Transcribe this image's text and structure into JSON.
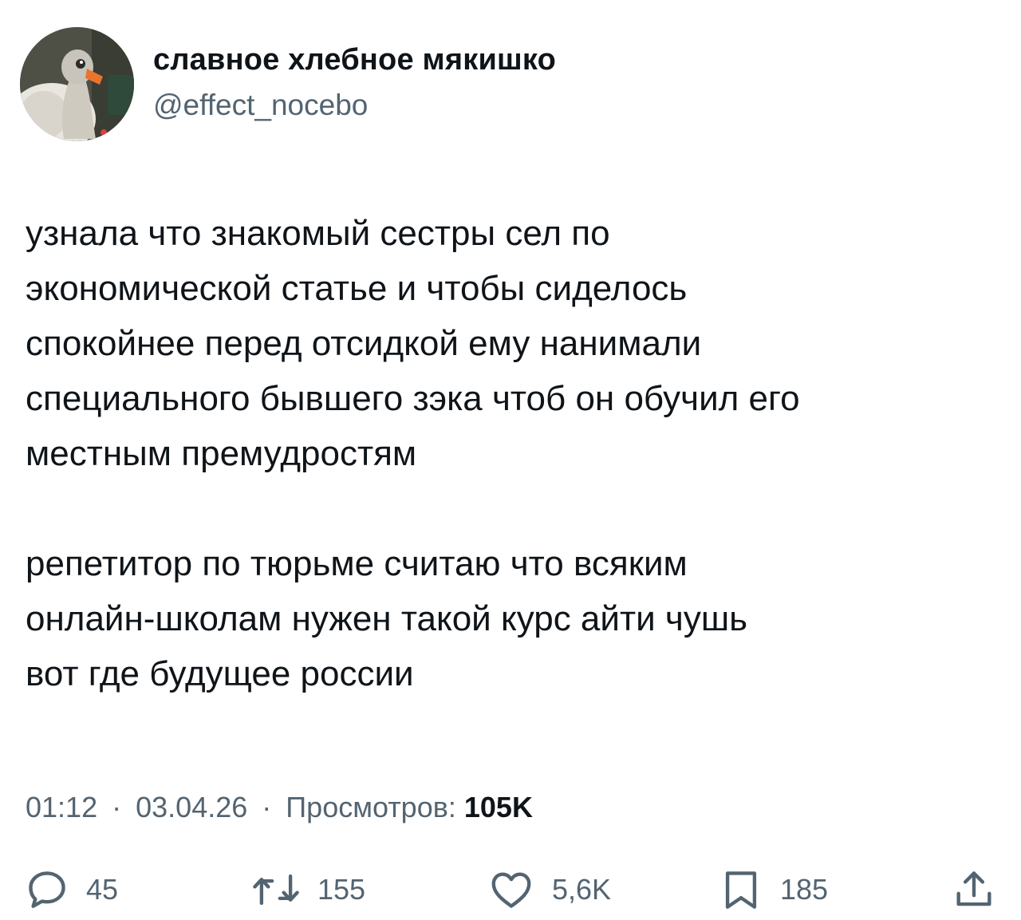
{
  "author": {
    "display_name": "славное хлебное мякишко",
    "handle": "@effect_nocebo",
    "avatar_icon": "goose-avatar"
  },
  "tweet": {
    "paragraphs": [
      {
        "lines": [
          "узнала что знакомый сестры сел по",
          "экономической статье и чтобы сиделось",
          "спокойнее перед отсидкой ему нанимали",
          "специального бывшего зэка чтоб он обучил его",
          "местным премудростям"
        ]
      },
      {
        "lines": [
          "репетитор по тюрьме считаю что всяким",
          "онлайн-школам нужен такой курс айти чушь",
          "вот где будущее россии"
        ]
      }
    ],
    "time": "01:12",
    "separator": "·",
    "date": "03.04.26",
    "views_label": "Просмотров:",
    "views_count": "105K"
  },
  "actions": {
    "reply": {
      "icon": "reply-icon",
      "count": "45"
    },
    "retweet": {
      "icon": "retweet-icon",
      "count": "155"
    },
    "like": {
      "icon": "heart-icon",
      "count": "5,6K"
    },
    "bookmark": {
      "icon": "bookmark-icon",
      "count": "185"
    },
    "share": {
      "icon": "share-icon"
    }
  },
  "colors": {
    "text_primary": "#0f1419",
    "text_secondary": "#536471",
    "background": "#ffffff"
  }
}
